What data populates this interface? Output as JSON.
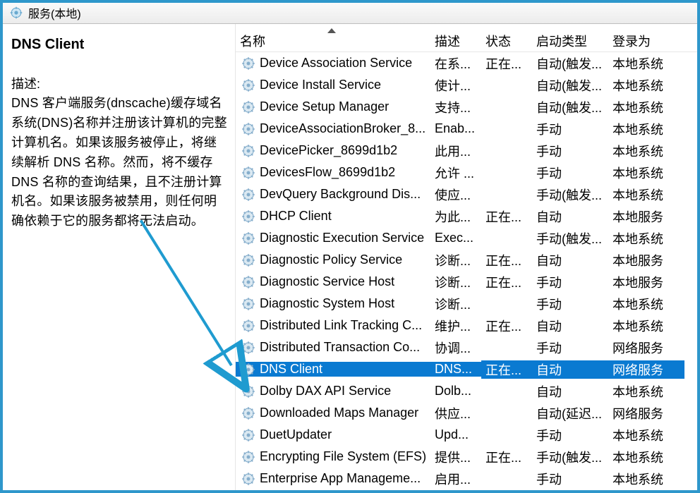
{
  "header": {
    "title": "服务(本地)"
  },
  "detail": {
    "title": "DNS Client",
    "desc_label": "描述:",
    "desc_text": "DNS 客户端服务(dnscache)缓存域名系统(DNS)名称并注册该计算机的完整计算机名。如果该服务被停止，将继续解析 DNS 名称。然而，将不缓存 DNS 名称的查询结果，且不注册计算机名。如果该服务被禁用，则任何明确依赖于它的服务都将无法启动。"
  },
  "columns": {
    "name": "名称",
    "desc": "描述",
    "status": "状态",
    "start": "启动类型",
    "logon": "登录为"
  },
  "services": [
    {
      "name": "Device Association Service",
      "desc": "在系...",
      "status": "正在...",
      "start": "自动(触发...",
      "logon": "本地系统"
    },
    {
      "name": "Device Install Service",
      "desc": "使计...",
      "status": "",
      "start": "自动(触发...",
      "logon": "本地系统"
    },
    {
      "name": "Device Setup Manager",
      "desc": "支持...",
      "status": "",
      "start": "自动(触发...",
      "logon": "本地系统"
    },
    {
      "name": "DeviceAssociationBroker_8...",
      "desc": "Enab...",
      "status": "",
      "start": "手动",
      "logon": "本地系统"
    },
    {
      "name": "DevicePicker_8699d1b2",
      "desc": "此用...",
      "status": "",
      "start": "手动",
      "logon": "本地系统"
    },
    {
      "name": "DevicesFlow_8699d1b2",
      "desc": "允许 ...",
      "status": "",
      "start": "手动",
      "logon": "本地系统"
    },
    {
      "name": "DevQuery Background Dis...",
      "desc": "使应...",
      "status": "",
      "start": "手动(触发...",
      "logon": "本地系统"
    },
    {
      "name": "DHCP Client",
      "desc": "为此...",
      "status": "正在...",
      "start": "自动",
      "logon": "本地服务"
    },
    {
      "name": "Diagnostic Execution Service",
      "desc": "Exec...",
      "status": "",
      "start": "手动(触发...",
      "logon": "本地系统"
    },
    {
      "name": "Diagnostic Policy Service",
      "desc": "诊断...",
      "status": "正在...",
      "start": "自动",
      "logon": "本地服务"
    },
    {
      "name": "Diagnostic Service Host",
      "desc": "诊断...",
      "status": "正在...",
      "start": "手动",
      "logon": "本地服务"
    },
    {
      "name": "Diagnostic System Host",
      "desc": "诊断...",
      "status": "",
      "start": "手动",
      "logon": "本地系统"
    },
    {
      "name": "Distributed Link Tracking C...",
      "desc": "维护...",
      "status": "正在...",
      "start": "自动",
      "logon": "本地系统"
    },
    {
      "name": "Distributed Transaction Co...",
      "desc": "协调...",
      "status": "",
      "start": "手动",
      "logon": "网络服务"
    },
    {
      "name": "DNS Client",
      "desc": "DNS...",
      "status": "正在...",
      "start": "自动",
      "logon": "网络服务",
      "selected": true
    },
    {
      "name": "Dolby DAX API Service",
      "desc": "Dolb...",
      "status": "",
      "start": "自动",
      "logon": "本地系统"
    },
    {
      "name": "Downloaded Maps Manager",
      "desc": "供应...",
      "status": "",
      "start": "自动(延迟...",
      "logon": "网络服务"
    },
    {
      "name": "DuetUpdater",
      "desc": "Upd...",
      "status": "",
      "start": "手动",
      "logon": "本地系统"
    },
    {
      "name": "Encrypting File System (EFS)",
      "desc": "提供...",
      "status": "正在...",
      "start": "手动(触发...",
      "logon": "本地系统"
    },
    {
      "name": "Enterprise App Manageme...",
      "desc": "启用...",
      "status": "",
      "start": "手动",
      "logon": "本地系统"
    }
  ]
}
